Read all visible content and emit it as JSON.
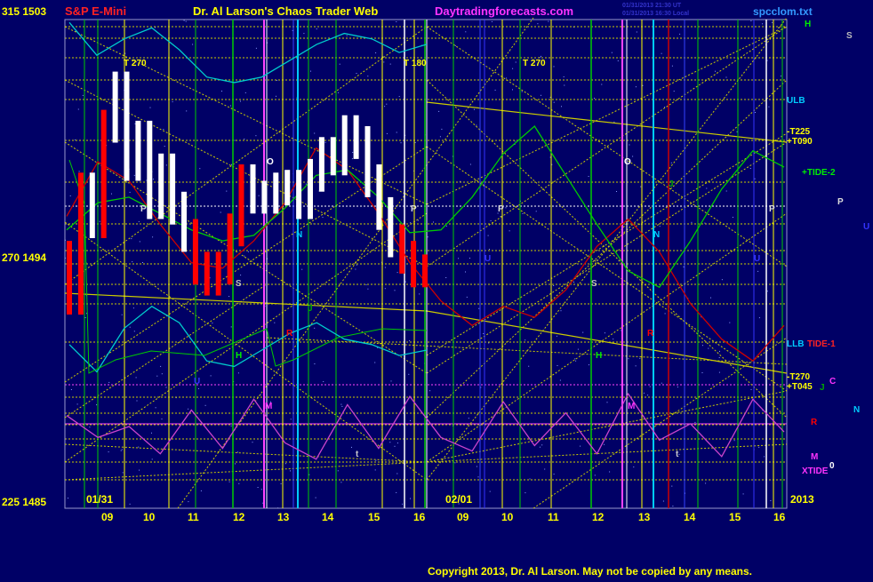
{
  "header": {
    "title_left": "S&P E-Mini",
    "title_center": "Dr. Al Larson's Chaos Trader Web",
    "site": "Daytradingforecasts.com",
    "file": "spcclom.txt",
    "timestamp_line1": "01/31/2013 21:30 UT",
    "timestamp_line2": "01/31/2013 16:30 Local"
  },
  "footer": {
    "copyright": "Copyright 2013, Dr. Al Larson. May not be copied by any means."
  },
  "colors": {
    "background": "#000066",
    "grid_yellow": "#cccc00",
    "price_white": "#ffffff",
    "price_red": "#ff0000",
    "tide1": "#cc0000",
    "tide2": "#00cc00",
    "bands": "#00cccc",
    "xtide": "#cc44cc"
  },
  "chart_data": {
    "type": "line",
    "title": "S&P E-Mini",
    "y_axis_left": {
      "ticks": [
        {
          "label": "315  1503",
          "price": 1503
        },
        {
          "label": "270  1494",
          "price": 1494
        },
        {
          "label": "225  1485",
          "price": 1485
        }
      ],
      "ylim": [
        1485,
        1503
      ]
    },
    "x_axis": {
      "hour_ticks": [
        "09",
        "10",
        "11",
        "12",
        "13",
        "14",
        "15",
        "16",
        "09",
        "10",
        "11",
        "12",
        "13",
        "14",
        "15",
        "16"
      ],
      "date_labels": [
        "01/31",
        "02/01"
      ],
      "year_label": "2013"
    },
    "series": [
      {
        "name": "TIDE-1",
        "values": [
          1495.5,
          1497.5,
          1496.8,
          1495.2,
          1493.8,
          1493.6,
          1494.6,
          1496.0,
          1498.0,
          1497.2,
          1495.6,
          1493.8,
          1492.4,
          1491.5,
          1492.2,
          1491.8,
          1492.8,
          1494.4,
          1495.4,
          1494.2,
          1492.3,
          1491.0,
          1490.2,
          1491.5
        ]
      },
      {
        "name": "TIDE-2",
        "values": [
          1495.0,
          1496.0,
          1496.2,
          1495.6,
          1495.0,
          1494.6,
          1494.8,
          1495.8,
          1497.0,
          1497.2,
          1496.2,
          1494.9,
          1495.0,
          1496.2,
          1497.8,
          1498.8,
          1497.0,
          1495.2,
          1493.5,
          1492.9,
          1494.6,
          1496.5,
          1497.9,
          1497.3
        ]
      },
      {
        "name": "XTIDE",
        "values": [
          1488.2,
          1487.4,
          1487.8,
          1486.8,
          1488.4,
          1487.0,
          1488.8,
          1487.2,
          1486.6,
          1488.6,
          1487.0,
          1488.9,
          1487.4,
          1486.9,
          1488.7,
          1487.1,
          1488.3,
          1486.8,
          1489.0,
          1487.3,
          1487.9,
          1486.7,
          1488.8,
          1487.6
        ]
      }
    ],
    "price_bars": {
      "high_color": "white",
      "low_color": "red",
      "values": [
        1494.0,
        1492.5,
        1496.5,
        1495.3,
        1498.8,
        1500.2,
        1497.4,
        1498.4,
        1496.0,
        1497.2,
        1495.8,
        1494.8,
        1493.6,
        1493.2,
        1493.6,
        1495.0,
        1496.8,
        1496.2,
        1496.2,
        1496.5,
        1496.6,
        1496.0,
        1497.0,
        1497.8,
        1497.6,
        1498.6,
        1498.2,
        1496.8,
        1495.6,
        1494.6,
        1494.0,
        1493.5
      ]
    },
    "upper_band": {
      "label": "ULB",
      "values": [
        1502.6,
        1501.4,
        1502.0,
        1502.4,
        1501.6,
        1500.6,
        1500.4,
        1500.6,
        1501.2,
        1501.8,
        1502.2,
        1502.0,
        1501.5,
        1501.8
      ]
    },
    "lower_band": {
      "label": "LLB",
      "values": [
        1490.8,
        1489.8,
        1491.4,
        1492.2,
        1491.6,
        1490.2,
        1490.0,
        1490.6,
        1491.2,
        1491.6,
        1491.0,
        1490.8,
        1490.4,
        1490.6
      ]
    },
    "vertical_markers": [
      {
        "label": "T  270",
        "hour": 9.5
      },
      {
        "label": "T  180",
        "hour": 15.6
      },
      {
        "label": "T  270",
        "hour": 10.2,
        "day": 2
      }
    ],
    "planet_letters_chart": [
      {
        "text": "P",
        "series_color": "#dddddd"
      },
      {
        "text": "O",
        "series_color": "#ffffff"
      },
      {
        "text": "N",
        "series_color": "#00ccff"
      },
      {
        "text": "S",
        "series_color": "#bbbbbb"
      },
      {
        "text": "H",
        "series_color": "#00ee00"
      },
      {
        "text": "R",
        "series_color": "#ff0000"
      },
      {
        "text": "M",
        "series_color": "#ff33ff"
      },
      {
        "text": "U",
        "series_color": "#3333ff"
      },
      {
        "text": "J",
        "series_color": "#00aa00"
      },
      {
        "text": "t",
        "series_color": "#cccccc"
      }
    ],
    "right_labels": [
      {
        "text": "H",
        "color": "#00ee00"
      },
      {
        "text": "S",
        "color": "#bbbbbb"
      },
      {
        "text": "ULB",
        "color": "#00ccff"
      },
      {
        "text": "-T225",
        "color": "#ffff00"
      },
      {
        "text": "+T090",
        "color": "#ffff00"
      },
      {
        "text": "+TIDE-2",
        "color": "#00ee00"
      },
      {
        "text": "P",
        "color": "#dddddd"
      },
      {
        "text": "U",
        "color": "#3333ff"
      },
      {
        "text": "LLB",
        "color": "#00ccff"
      },
      {
        "text": "TIDE-1",
        "color": "#ff2222"
      },
      {
        "text": "-T270",
        "color": "#ffff00"
      },
      {
        "text": "+T045",
        "color": "#ffff00"
      },
      {
        "text": "J",
        "color": "#00aa00"
      },
      {
        "text": "C",
        "color": "#ff33ff"
      },
      {
        "text": "N",
        "color": "#00ccff"
      },
      {
        "text": "R",
        "color": "#ff0000"
      },
      {
        "text": "M",
        "color": "#ff33ff"
      },
      {
        "text": "XTIDE",
        "color": "#ff33ff"
      },
      {
        "text": "0",
        "color": "#ffffff"
      }
    ]
  }
}
